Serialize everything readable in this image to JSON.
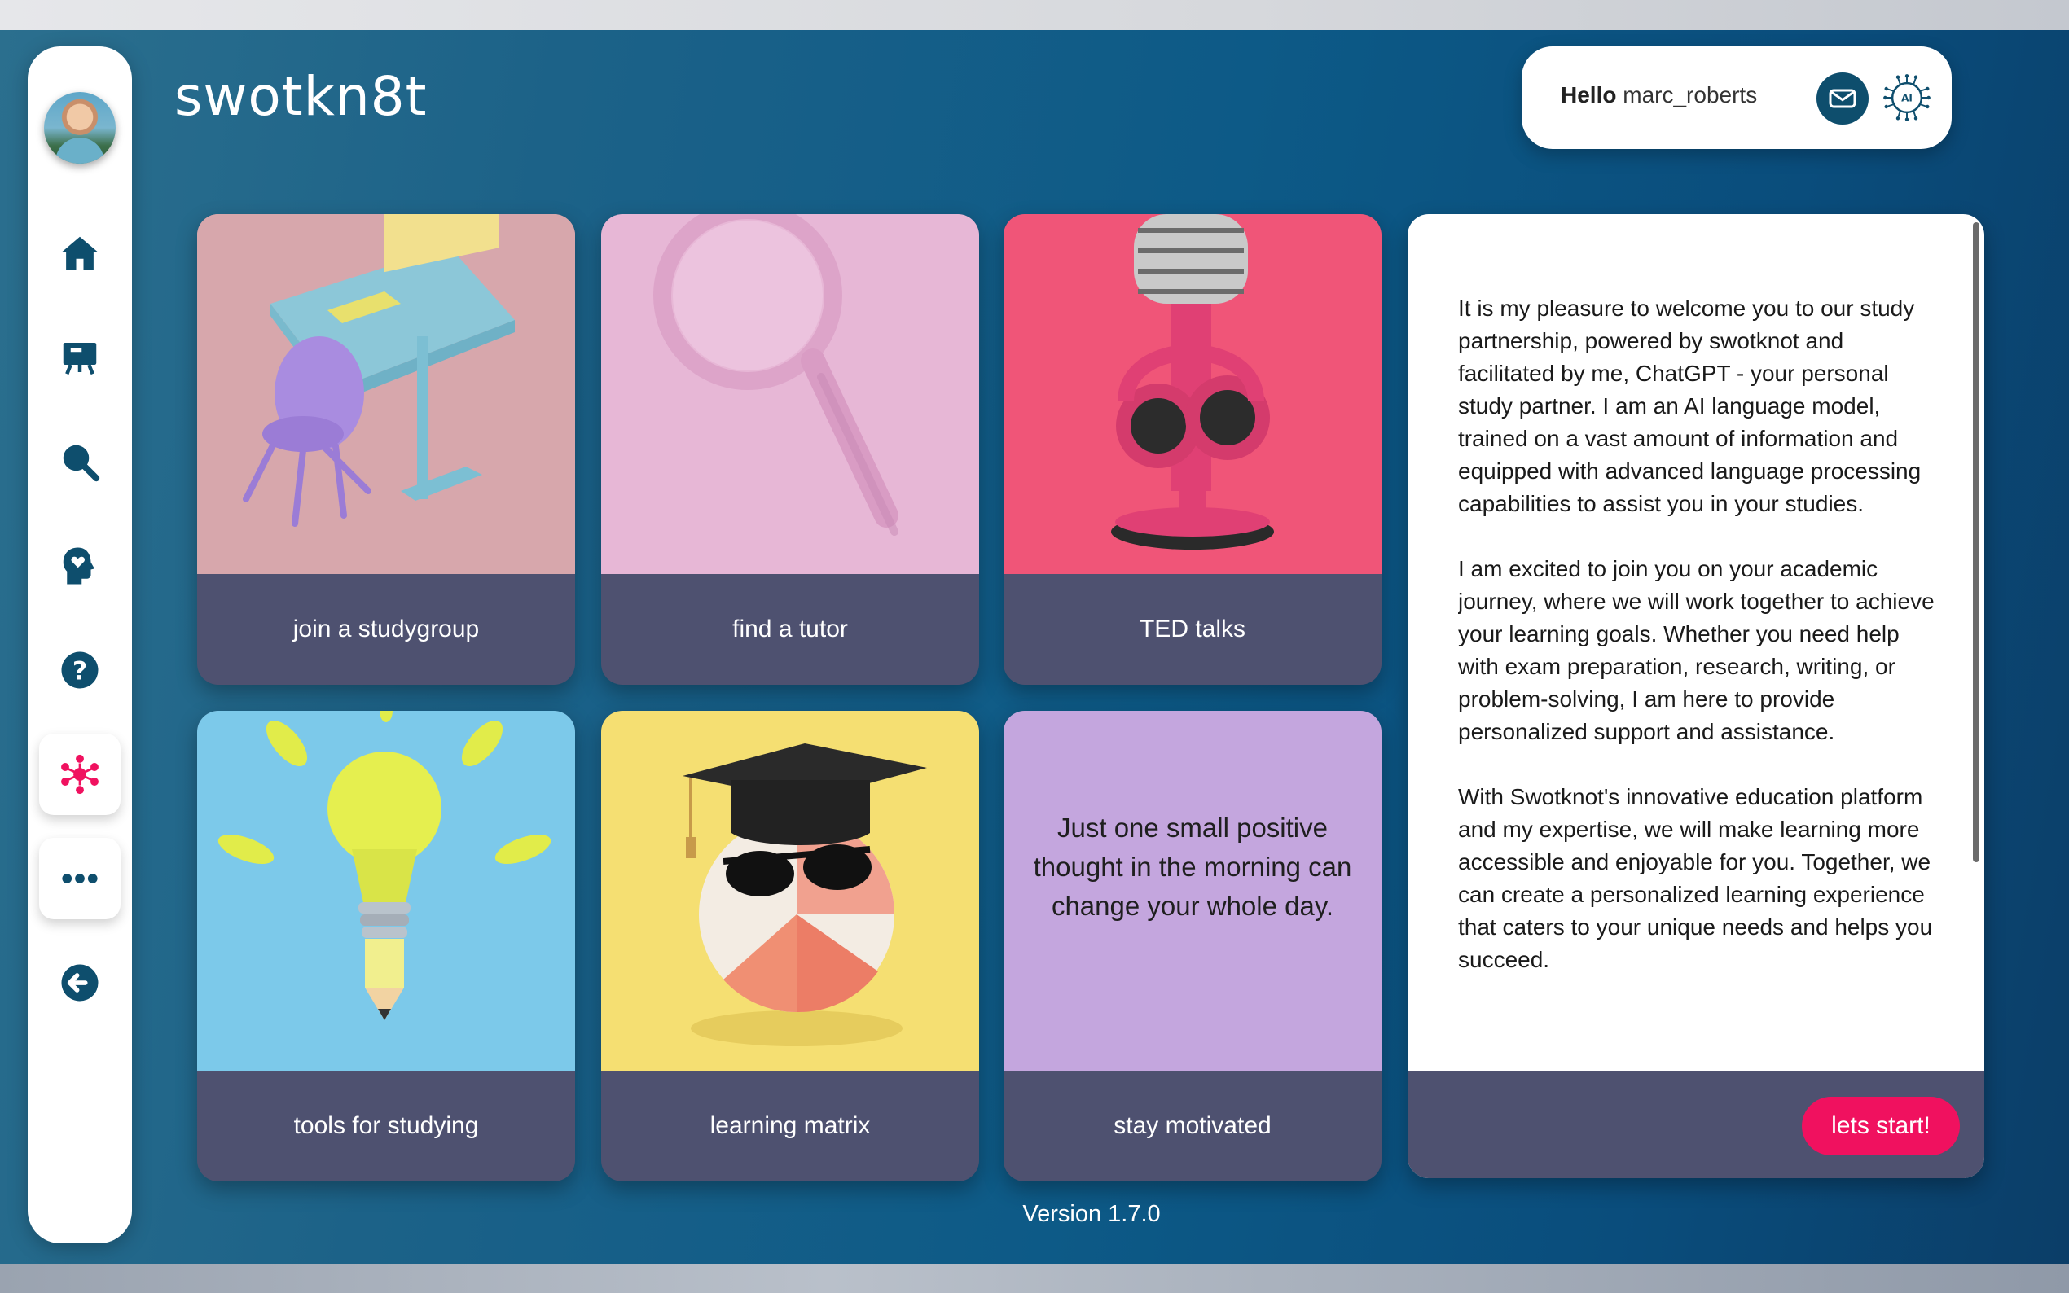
{
  "app": {
    "logo": "swotkn8t",
    "version": "Version 1.7.0"
  },
  "header": {
    "greeting": "Hello",
    "username": "marc_roberts"
  },
  "sidebar": {
    "items": [
      {
        "name": "home-icon"
      },
      {
        "name": "presentation-board-icon"
      },
      {
        "name": "search-icon"
      },
      {
        "name": "head-heart-icon"
      },
      {
        "name": "help-icon"
      },
      {
        "name": "network-icon",
        "active": true
      },
      {
        "name": "more-icon"
      },
      {
        "name": "logout-icon"
      }
    ]
  },
  "cards": [
    {
      "label": "join a studygroup"
    },
    {
      "label": "find a tutor"
    },
    {
      "label": "TED talks"
    },
    {
      "label": "tools for studying"
    },
    {
      "label": "learning matrix"
    },
    {
      "label": "stay motivated",
      "quote": "Just one small positive thought in the morning can change your whole day."
    }
  ],
  "welcome": {
    "paragraphs": [
      "It is my pleasure to welcome you to our study partnership, powered by swotknot and facilitated by me, ChatGPT - your personal study partner. I am an AI language model, trained on a vast amount of information and equipped with advanced language processing capabilities to assist you in your studies.",
      "I am excited to join you on your academic journey, where we will work together to achieve your learning goals. Whether you need help with exam preparation, research, writing, or problem-solving, I am here to provide personalized support and assistance.",
      "With Swotknot's innovative education platform and my expertise, we will make learning more accessible and enjoyable for you. Together, we can create a personalized learning experience that caters to your unique needs and helps you succeed."
    ],
    "start_label": "lets start!"
  },
  "colors": {
    "accent": "#f0115f",
    "card_footer": "#4e5170",
    "icon": "#0e4e6d",
    "active_icon": "#f0115f"
  }
}
